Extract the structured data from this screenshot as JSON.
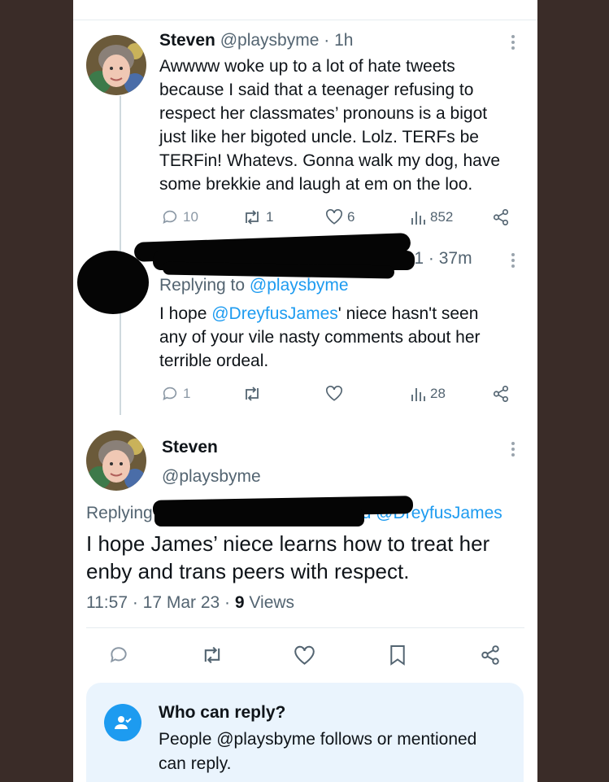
{
  "tweet1": {
    "name": "Steven",
    "handle": "@playsbyme",
    "time": "· 1h",
    "lines": [
      "Awwww woke up to a lot of hate tweets",
      "because I said that a teenager refusing to",
      "respect her classmates’ pronouns is a bigot",
      "just like her bigoted uncle. Lolz. TERFs be",
      "TERFin! Whatevs. Gonna walk my dog, have",
      "some brekkie and laugh at em on the loo."
    ],
    "replies": "10",
    "retweets": "1",
    "likes": "6",
    "views": "852"
  },
  "tweet2": {
    "handle_fragment": "991",
    "time": "· 37m",
    "replying_prefix": "Replying to ",
    "replying_handle": "@playsbyme",
    "text_prefix": "I hope ",
    "text_mention": "@DreyfusJames",
    "text_line1_suffix": "' niece hasn't seen",
    "text_line2": "any of your vile nasty comments about her",
    "text_line3": "terrible ordeal.",
    "replies": "1",
    "views": "28"
  },
  "main_tweet": {
    "name": "Steven",
    "handle": "@playsbyme",
    "replying_prefix": "Replying",
    "replying_fragment": "d ",
    "replying_handle": "@DreyfusJames",
    "line1": "I hope James’ niece learns how to treat her",
    "line2": "enby and trans peers with respect.",
    "timestamp": "11:57 · 17 Mar 23 · ",
    "views_count": "9",
    "views_label": " Views"
  },
  "who_can_reply": {
    "title": "Who can reply?",
    "line1": "People @playsbyme follows or mentioned",
    "line2": "can reply."
  },
  "colors": {
    "accent": "#1d9bf0",
    "muted": "#536471",
    "background": "#3a2c28"
  },
  "icons": [
    "reply-icon",
    "retweet-icon",
    "like-icon",
    "views-icon",
    "share-icon",
    "bookmark-icon",
    "more-icon",
    "person-check-icon"
  ]
}
